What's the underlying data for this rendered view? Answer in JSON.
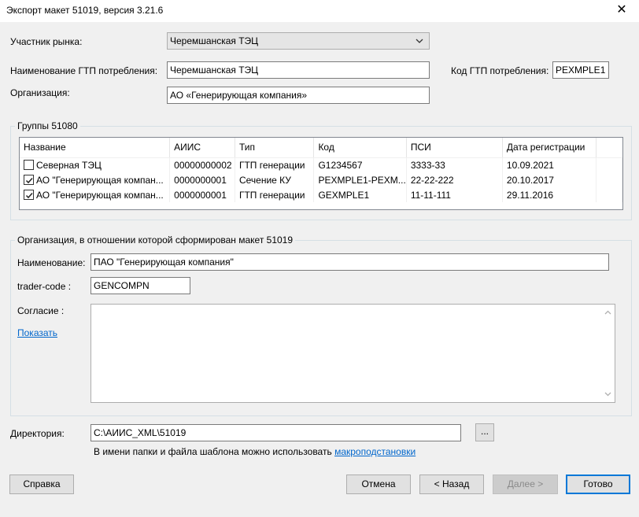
{
  "window": {
    "title": "Экспорт макет 51019, версия 3.21.6",
    "close_glyph": "✕"
  },
  "market_participant": {
    "label": "Участник рынка:",
    "value": "Черемшанская ТЭЦ"
  },
  "gtp_name": {
    "label": "Наименование ГТП потребления:",
    "value": "Черемшанская ТЭЦ"
  },
  "gtp_code": {
    "label": "Код ГТП потребления:",
    "value": "PEXMPLE1"
  },
  "organization": {
    "label": "Организация:",
    "value": "АО «Генерирующая компания»"
  },
  "groups": {
    "caption": "Группы 51080",
    "columns": [
      "Название",
      "АИИС",
      "Тип",
      "Код",
      "ПСИ",
      "Дата регистрации"
    ],
    "rows": [
      {
        "checked": false,
        "name": "Северная ТЭЦ",
        "aiis": "00000000002",
        "type": "ГТП генерации",
        "code": "G1234567",
        "psi": "3333-33",
        "date": "10.09.2021"
      },
      {
        "checked": true,
        "name": "АО \"Генерирующая компан...",
        "aiis": "0000000001",
        "type": "Сечение КУ",
        "code": "PEXMPLE1-PEXM...",
        "psi": "22-22-222",
        "date": "20.10.2017"
      },
      {
        "checked": true,
        "name": "АО \"Генерирующая компан...",
        "aiis": "0000000001",
        "type": "ГТП генерации",
        "code": "GEXMPLE1",
        "psi": "11-11-111",
        "date": "29.11.2016"
      }
    ]
  },
  "org_section": {
    "caption": "Организация, в отношении которой сформирован макет 51019",
    "name_label": "Наименование:",
    "name_value": "ПАО \"Генерирующая компания\"",
    "trader_label": "trader-code :",
    "trader_value": "GENCOMPN",
    "consent_label": "Согласие :",
    "show_link": "Показать",
    "consent_text": ""
  },
  "directory": {
    "label": "Директория:",
    "value": "C:\\АИИС_XML\\51019",
    "browse_label": "...",
    "hint": "В имени папки и файла шаблона можно использовать",
    "hint_link": "макроподстановки"
  },
  "buttons": {
    "help": "Справка",
    "cancel": "Отмена",
    "back": "< Назад",
    "next": "Далее >",
    "done": "Готово"
  }
}
